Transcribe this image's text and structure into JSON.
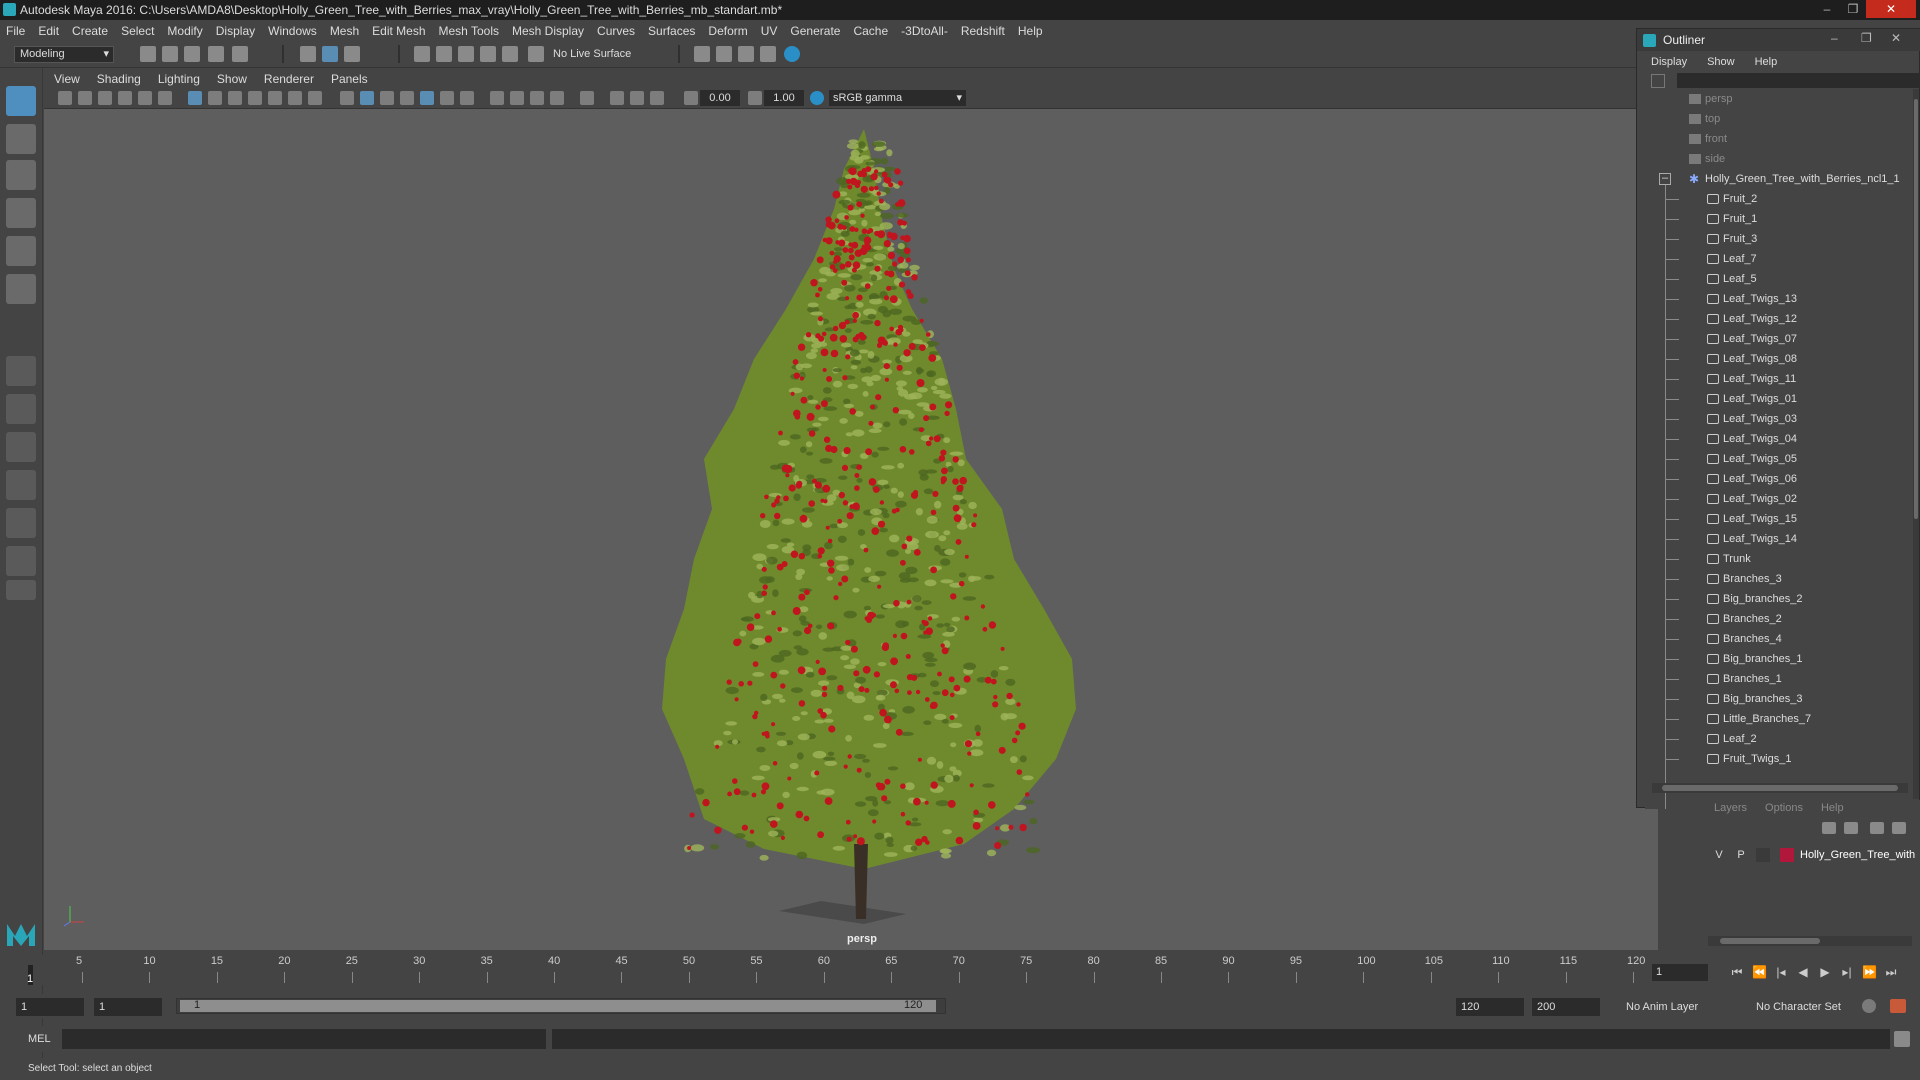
{
  "window": {
    "title": "Autodesk Maya 2016: C:\\Users\\AMDA8\\Desktop\\Holly_Green_Tree_with_Berries_max_vray\\Holly_Green_Tree_with_Berries_mb_standart.mb*",
    "minimize": "–",
    "maximize": "❐",
    "close": "✕"
  },
  "menubar": [
    "File",
    "Edit",
    "Create",
    "Select",
    "Modify",
    "Display",
    "Windows",
    "Mesh",
    "Edit Mesh",
    "Mesh Tools",
    "Mesh Display",
    "Curves",
    "Surfaces",
    "Deform",
    "UV",
    "Generate",
    "Cache",
    "-3DtoAll-",
    "Redshift",
    "Help"
  ],
  "shelf": {
    "mode": "Modeling",
    "live_surface": "No Live Surface"
  },
  "viewport": {
    "menu": [
      "View",
      "Shading",
      "Lighting",
      "Show",
      "Renderer",
      "Panels"
    ],
    "exposure": "0.00",
    "gamma": "1.00",
    "color_space": "sRGB gamma",
    "camera": "persp"
  },
  "outliner": {
    "title": "Outliner",
    "menu": [
      "Display",
      "Show",
      "Help"
    ],
    "cameras": [
      "persp",
      "top",
      "front",
      "side"
    ],
    "group": "Holly_Green_Tree_with_Berries_ncl1_1",
    "items": [
      "Fruit_2",
      "Fruit_1",
      "Fruit_3",
      "Leaf_7",
      "Leaf_5",
      "Leaf_Twigs_13",
      "Leaf_Twigs_12",
      "Leaf_Twigs_07",
      "Leaf_Twigs_08",
      "Leaf_Twigs_11",
      "Leaf_Twigs_01",
      "Leaf_Twigs_03",
      "Leaf_Twigs_04",
      "Leaf_Twigs_05",
      "Leaf_Twigs_06",
      "Leaf_Twigs_02",
      "Leaf_Twigs_15",
      "Leaf_Twigs_14",
      "Trunk",
      "Branches_3",
      "Big_branches_2",
      "Branches_2",
      "Branches_4",
      "Big_branches_1",
      "Branches_1",
      "Big_branches_3",
      "Little_Branches_7",
      "Leaf_2",
      "Fruit_Twigs_1"
    ]
  },
  "layers": {
    "menu": [
      "Layers",
      "Options",
      "Help"
    ],
    "visible": "V",
    "playback": "P",
    "layer_name": "Holly_Green_Tree_with",
    "layer_color": "#b0173a"
  },
  "timeline": {
    "ticks": [
      "5",
      "10",
      "15",
      "20",
      "25",
      "30",
      "35",
      "40",
      "45",
      "50",
      "55",
      "60",
      "65",
      "70",
      "75",
      "80",
      "85",
      "90",
      "95",
      "100",
      "105",
      "110",
      "115",
      "120"
    ],
    "first_tick": "1",
    "current_frame": "1"
  },
  "range": {
    "start": "1",
    "anim_start": "1",
    "slider_start": "1",
    "slider_end": "120",
    "anim_end": "120",
    "max_end": "200",
    "anim_layer": "No Anim Layer",
    "character_set": "No Character Set"
  },
  "command": {
    "label": "MEL"
  },
  "help_line": "Select Tool: select an object",
  "colors": {
    "bg": "#444444",
    "viewport": "#5e5e5e",
    "field": "#2b2b2b",
    "accent": "#2aa7b8",
    "berry": "#c0141e",
    "leaf": "#6f8a2c"
  }
}
